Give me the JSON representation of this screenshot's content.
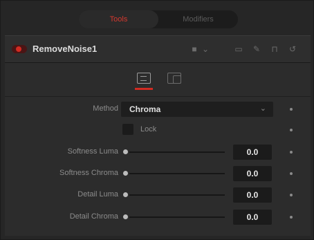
{
  "tabs": [
    {
      "label": "Tools",
      "active": true
    },
    {
      "label": "Modifiers",
      "active": false
    }
  ],
  "header": {
    "node_name": "RemoveNoise1",
    "icons": [
      "square-icon",
      "chevron-down-icon",
      "folder-icon",
      "pin-icon",
      "lock-icon",
      "reset-icon"
    ]
  },
  "controls": {
    "method": {
      "label": "Method",
      "value": "Chroma"
    },
    "lock": {
      "label": "Lock",
      "checked": false
    },
    "sliders": [
      {
        "label": "Softness Luma",
        "value": "0.0",
        "level": 0
      },
      {
        "label": "Softness Chroma",
        "value": "0.0",
        "level": 0
      },
      {
        "label": "Detail Luma",
        "value": "0.0",
        "level": 0
      },
      {
        "label": "Detail Chroma",
        "value": "0.0",
        "level": 0
      }
    ]
  },
  "colors": {
    "accent": "#d22b22",
    "background": "#262626"
  }
}
